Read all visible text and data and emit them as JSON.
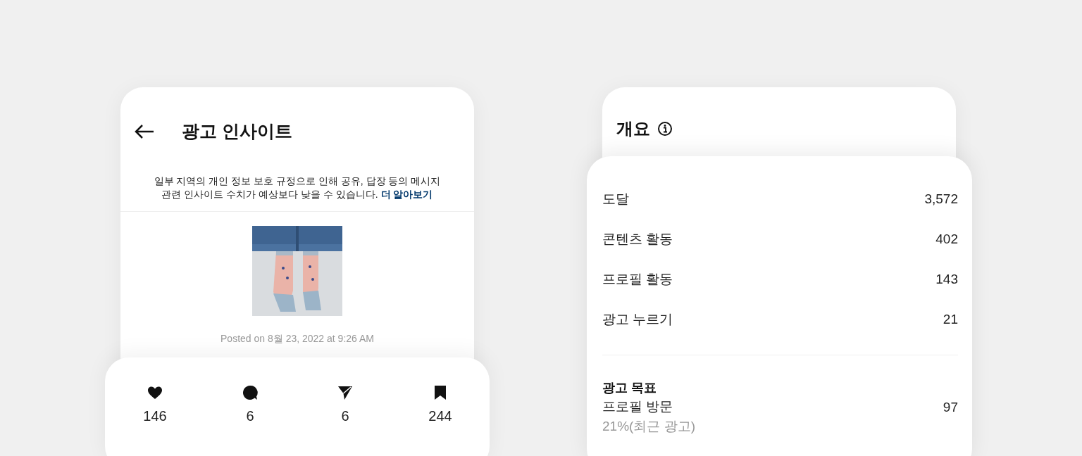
{
  "insights_card": {
    "title": "광고 인사이트",
    "notice": "일부 지역의 개인 정보 보호 규정으로 인해 공유, 답장 등의 메시지\n관련 인사이트 수치가 예상보다 낮을 수 있습니다. ",
    "notice_link": "더 알아보기",
    "posted": "Posted on 8월 23, 2022 at 9:26 AM"
  },
  "engagement": [
    {
      "kind": "like",
      "count": "146"
    },
    {
      "kind": "comment",
      "count": "6"
    },
    {
      "kind": "share",
      "count": "6"
    },
    {
      "kind": "save",
      "count": "244"
    }
  ],
  "overview": {
    "title": "개요",
    "metrics": [
      {
        "label": "도달",
        "value": "3,572"
      },
      {
        "label": "콘텐츠 활동",
        "value": "402"
      },
      {
        "label": "프로필 활동",
        "value": "143"
      },
      {
        "label": "광고 누르기",
        "value": "21"
      }
    ],
    "goal": {
      "title": "광고 목표",
      "label": "프로필 방문",
      "value": "97",
      "note": "21%(최근 광고)"
    }
  }
}
